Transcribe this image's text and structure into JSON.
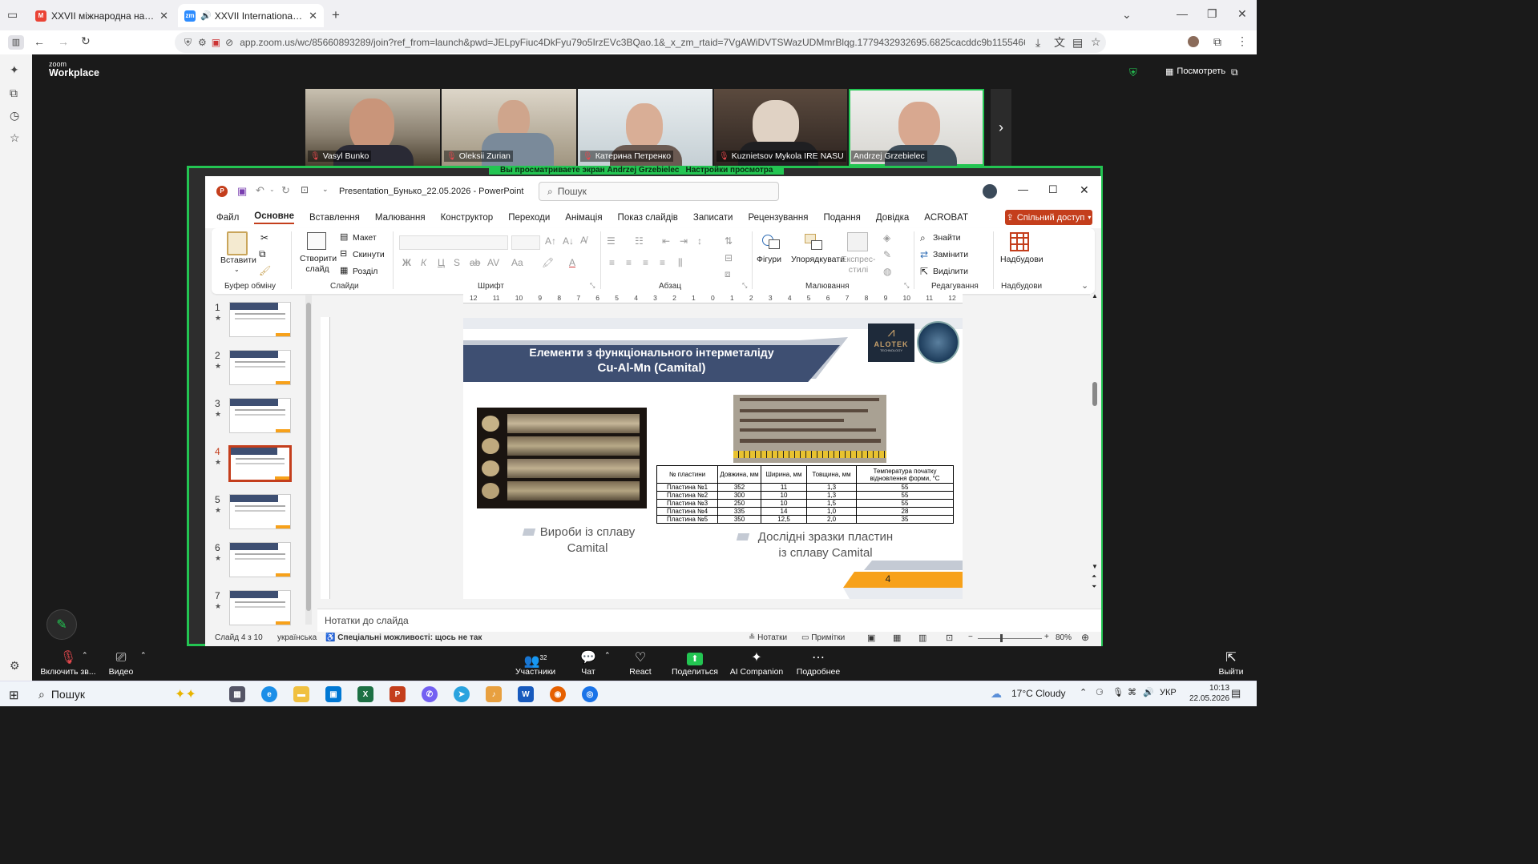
{
  "browser": {
    "tabs": [
      {
        "title": "XXVII міжнародна науково-пр",
        "active": false
      },
      {
        "title": "XXVII International Scientifi",
        "active": true
      }
    ],
    "url": "app.zoom.us/wc/85660893289/join?ref_from=launch&pwd=JELpyFiuc4DkFyu79o5IrzEVc3BQao.1&_x_zm_rtaid=7VgAWiDVTSWazUDMmrBlqg.1779432932695.6825cacddc9b115546602ead543cf8c8&"
  },
  "zoom": {
    "logo_line1": "zoom",
    "logo_line2": "Workplace",
    "view_label": "Посмотреть",
    "sharing_banner": "Вы просматриваете экран Andrzej Grzebielec",
    "view_options": "Настройки просмотра",
    "participants": [
      {
        "name": "Vasyl Bunko",
        "muted": true
      },
      {
        "name": "Oleksii Zurian",
        "muted": true
      },
      {
        "name": "Катерина Петренко",
        "muted": true
      },
      {
        "name": "Kuznietsov Mykola IRE NASU",
        "muted": true
      },
      {
        "name": "Andrzej Grzebielec",
        "muted": false
      }
    ],
    "toolbar": {
      "audio": "Включить зв...",
      "video": "Видео",
      "participants": "Участники",
      "participants_count": "32",
      "chat": "Чат",
      "react": "React",
      "share": "Поделиться",
      "ai": "AI Companion",
      "more": "Подробнее",
      "leave": "Выйти"
    }
  },
  "ppt": {
    "filename": "Presentation_Бунько_22.05.2026",
    "app": "PowerPoint",
    "search_placeholder": "Пошук",
    "menu": [
      "Файл",
      "Основне",
      "Вставлення",
      "Малювання",
      "Конструктор",
      "Переходи",
      "Анімація",
      "Показ слайдів",
      "Записати",
      "Рецензування",
      "Подання",
      "Довідка",
      "ACROBAT"
    ],
    "share_button": "Спільний доступ",
    "ribbon": {
      "paste": "Вставити",
      "clipboard": "Буфер обміну",
      "new_slide": "Створити слайд",
      "layout": "Макет",
      "reset": "Скинути",
      "section": "Розділ",
      "slides": "Слайди",
      "font": "Шрифт",
      "paragraph": "Абзац",
      "shapes": "Фігури",
      "arrange": "Упорядкувати",
      "quick_styles": "Експрес-стилі",
      "drawing": "Малювання",
      "find": "Знайти",
      "replace": "Замінити",
      "select": "Виділити",
      "editing": "Редагування",
      "addins": "Надбудови",
      "addins_group": "Надбудови"
    },
    "ruler_ticks": [
      "12",
      "11",
      "10",
      "9",
      "8",
      "7",
      "6",
      "5",
      "4",
      "3",
      "2",
      "1",
      "0",
      "1",
      "2",
      "3",
      "4",
      "5",
      "6",
      "7",
      "8",
      "9",
      "10",
      "11",
      "12"
    ],
    "thumbs": [
      "1",
      "2",
      "3",
      "4",
      "5",
      "6",
      "7"
    ],
    "selected_thumb": 3,
    "notes_placeholder": "Нотатки до слайда",
    "status": {
      "slide": "Слайд 4 з 10",
      "lang": "українська",
      "accessibility": "Спеціальні можливості: щось не так",
      "notes": "Нотатки",
      "comments": "Примітки",
      "zoom": "80%"
    }
  },
  "slide": {
    "title_line1": "Елементи з функціонального інтерметаліду",
    "title_line2": "Cu-Al-Mn (Camital)",
    "logo_text": "ALOTEK",
    "logo_sub": "TECHNOLOGY",
    "caption_left_1": "Вироби із сплаву",
    "caption_left_2": "Camital",
    "caption_right_1": "Дослідні зразки пластин",
    "caption_right_2": "із сплаву Camital",
    "page_number": "4",
    "table": {
      "headers": [
        "№ пластини",
        "Довжина, мм",
        "Ширина, мм",
        "Товщина, мм",
        "Температура початку відновлення форми, °С"
      ],
      "rows": [
        [
          "Пластина №1",
          "352",
          "11",
          "1,3",
          "55"
        ],
        [
          "Пластина №2",
          "300",
          "10",
          "1,3",
          "55"
        ],
        [
          "Пластина №3",
          "250",
          "10",
          "1,5",
          "55"
        ],
        [
          "Пластина №4",
          "335",
          "14",
          "1,0",
          "28"
        ],
        [
          "Пластина №5",
          "350",
          "12,5",
          "2,0",
          "35"
        ]
      ]
    }
  },
  "taskbar": {
    "search": "Пошук",
    "weather_temp": "17°C",
    "weather_text": "Cloudy",
    "lang": "УКР",
    "time": "10:13",
    "date": "22.05.2026"
  }
}
